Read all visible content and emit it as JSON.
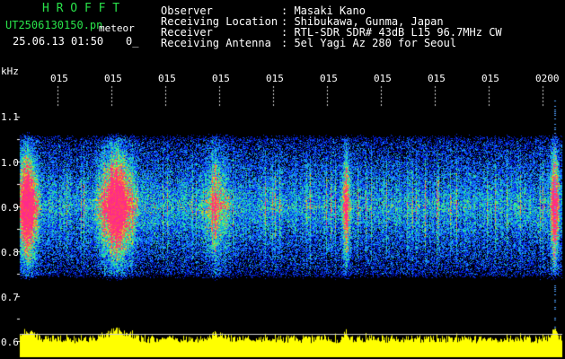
{
  "header": {
    "app_name": "H R O F F T",
    "file_name": "UT2506130150.pn",
    "mode": "meteor",
    "datetime": "25.06.13 01:50",
    "counter": "0_",
    "fields": [
      {
        "label": "Observer",
        "value": ": Masaki Kano"
      },
      {
        "label": "Receiving Location",
        "value": ": Shibukawa, Gunma, Japan"
      },
      {
        "label": "Receiver",
        "value": ": RTL-SDR SDR# 43dB L15 96.7MHz CW"
      },
      {
        "label": "Receiving Antenna",
        "value": ": 5el Yagi Az 280 for Seoul"
      }
    ]
  },
  "chart_data": {
    "type": "heatmap",
    "ylabel": "kHz",
    "y_ticks": [
      "1.1",
      "1.0",
      "0.9",
      "0.8",
      "0.7",
      "0.6"
    ],
    "x_ticks": [
      "015",
      "015",
      "015",
      "015",
      "015",
      "015",
      "015",
      "015",
      "015",
      "0200"
    ],
    "ylim": [
      0.6,
      1.15
    ],
    "band_khz": [
      0.75,
      1.05
    ],
    "colors": {
      "low": "#0000ff",
      "mid": "#00ffcc",
      "high": "#ff2a8a",
      "power": "#ffff00"
    }
  }
}
